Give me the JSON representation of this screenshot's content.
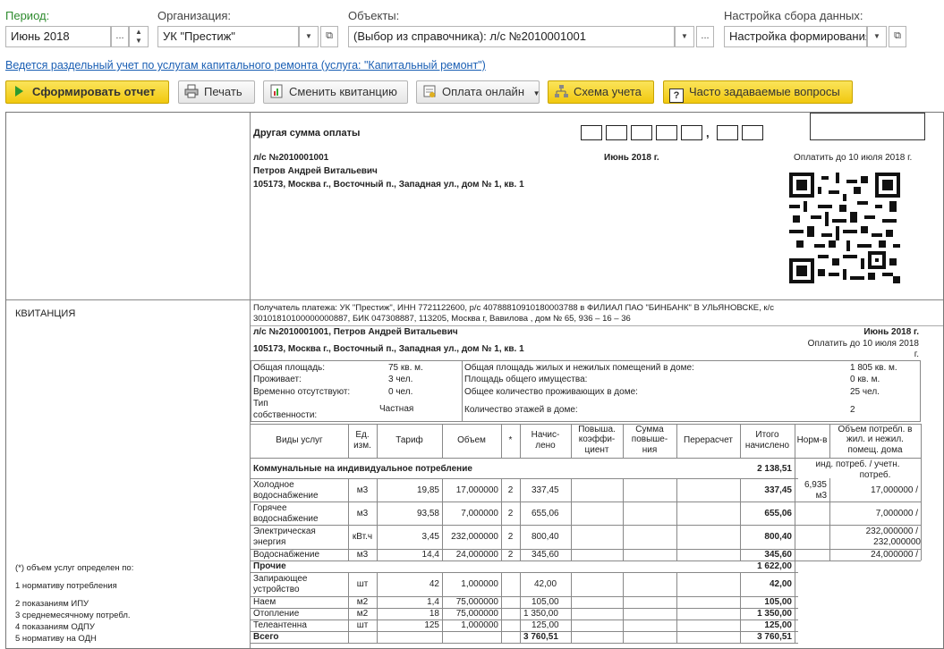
{
  "header": {
    "period_label": "Период:",
    "period_value": "Июнь 2018",
    "org_label": "Организация:",
    "org_value": "УК \"Престиж\"",
    "objects_label": "Объекты:",
    "objects_value": "(Выбор из справочника): л/с №2010001001",
    "settings_label": "Настройка сбора данных:",
    "settings_value": "Настройка формирования",
    "dots": "..."
  },
  "info_link": "Ведется раздельный учет по услугам капитального ремонта (услуга: \"Капитальный ремонт\")",
  "toolbar": {
    "generate": "Сформировать отчет",
    "print": "Печать",
    "change_receipt": "Сменить квитанцию",
    "pay_online": "Оплата онлайн",
    "scheme": "Схема учета",
    "faq": "Часто задаваемые вопросы"
  },
  "notice": {
    "other_sum": "Другая сумма оплаты",
    "account": "л/с №2010001001",
    "name": "Петров Андрей Витальевич",
    "address": "105173, Москва г., Восточный п., Западная ул., дом № 1, кв. 1",
    "period": "Июнь 2018 г.",
    "pay_until": "Оплатить до 10 июля 2018 г.",
    "comma": ","
  },
  "receipt": {
    "title": "КВИТАНЦИЯ",
    "recipient_line1": "Получатель платежа: УК \"Престиж\", ИНН 7721122600, р/с 40788810910180003788 в ФИЛИАЛ ПАО \"БИНБАНК\" В УЛЬЯНОВСКЕ, к/с",
    "recipient_line2": "30101810100000000887, БИК 047308887, 113205, Москва г, Вавилова , дом № 65, 936 – 16 – 36",
    "account_name": "л/с №2010001001, Петров Андрей Витальевич",
    "address": "105173, Москва г., Восточный п., Западная ул., дом № 1, кв. 1",
    "period": "Июнь 2018 г.",
    "pay_until_1": "Оплатить до 10 июля 2018",
    "pay_until_2": "г.",
    "footnote_title": "(*) объем услуг определен по:",
    "footnotes": [
      "1 нормативу потребления",
      "2 показаниям ИПУ",
      "3 среднемесячному потребл.",
      "4 показаниям ОДПУ",
      "5 нормативу на ОДН"
    ]
  },
  "props": {
    "area_label": "Общая площадь:",
    "area_value": "75 кв. м.",
    "residents_label": "Проживает:",
    "residents_value": "3 чел.",
    "absent_label": "Временно отсутствуют:",
    "absent_value": "0 чел.",
    "ownership_label_1": "Тип",
    "ownership_label_2": "собственности:",
    "ownership_value": "Частная",
    "house_area_label": "Общая площадь жилых и нежилых помещений в доме:",
    "house_area_value": "1 805 кв. м.",
    "common_area_label": "Площадь общего имущества:",
    "common_area_value": "0 кв. м.",
    "house_residents_label": "Общее количество проживающих в доме:",
    "house_residents_value": "25 чел.",
    "floors_label": "Количество этажей в доме:",
    "floors_value": "2"
  },
  "table": {
    "headers": {
      "service": "Виды услуг",
      "unit_1": "Ед.",
      "unit_2": "изм.",
      "tariff": "Тариф",
      "volume": "Объем",
      "star": "*",
      "accrued_1": "Начис-",
      "accrued_2": "лено",
      "coef_1": "Повыша.",
      "coef_2": "коэффи-",
      "coef_3": "циент",
      "inc_1": "Сумма",
      "inc_2": "повыше-",
      "inc_3": "ния",
      "recalc": "Перерасчет",
      "total_1": "Итого",
      "total_2": "начислено",
      "norm": "Норм-в",
      "hv_1": "Объем потребл. в",
      "hv_2": "жил. и нежил.",
      "hv_3": "помещ. дома"
    },
    "group1": {
      "label": "Коммунальные на индивидуальное потребление",
      "total": "2 138,51",
      "note_1": "инд. потреб. / учетн.",
      "note_2": "потреб."
    },
    "rows": [
      {
        "name_1": "Холодное",
        "name_2": "водоснабжение",
        "unit": "м3",
        "tariff": "19,85",
        "volume": "17,000000",
        "star": "2",
        "accrued": "337,45",
        "total": "337,45",
        "norm_1": "6,935",
        "norm_2": "м3",
        "hv_1": "17,000000 /",
        "hv_2": ""
      },
      {
        "name_1": "Горячее",
        "name_2": "водоснабжение",
        "unit": "м3",
        "tariff": "93,58",
        "volume": "7,000000",
        "star": "2",
        "accrued": "655,06",
        "total": "655,06",
        "norm_1": "",
        "norm_2": "",
        "hv_1": "7,000000 /",
        "hv_2": ""
      },
      {
        "name_1": "Электрическая",
        "name_2": "энергия",
        "unit": "кВт.ч",
        "tariff": "3,45",
        "volume": "232,000000",
        "star": "2",
        "accrued": "800,40",
        "total": "800,40",
        "norm_1": "",
        "norm_2": "",
        "hv_1": "232,000000 /",
        "hv_2": "232,000000"
      },
      {
        "name_1": "Водоснабжение",
        "name_2": "",
        "unit": "м3",
        "tariff": "14,4",
        "volume": "24,000000",
        "star": "2",
        "accrued": "345,60",
        "total": "345,60",
        "norm_1": "",
        "norm_2": "",
        "hv_1": "24,000000 /",
        "hv_2": ""
      }
    ],
    "group2": {
      "label": "Прочие",
      "total": "1 622,00"
    },
    "rows2": [
      {
        "name_1": "Запирающее",
        "name_2": "устройство",
        "unit": "шт",
        "tariff": "42",
        "volume": "1,000000",
        "accrued": "42,00",
        "total": "42,00"
      },
      {
        "name_1": "Наем",
        "name_2": "",
        "unit": "м2",
        "tariff": "1,4",
        "volume": "75,000000",
        "accrued": "105,00",
        "total": "105,00"
      },
      {
        "name_1": "Отопление",
        "name_2": "",
        "unit": "м2",
        "tariff": "18",
        "volume": "75,000000",
        "accrued": "1 350,00",
        "total": "1 350,00"
      },
      {
        "name_1": "Телеантенна",
        "name_2": "",
        "unit": "шт",
        "tariff": "125",
        "volume": "1,000000",
        "accrued": "125,00",
        "total": "125,00"
      }
    ],
    "grand": {
      "label": "Всего",
      "accrued": "3 760,51",
      "total": "3 760,51"
    }
  }
}
